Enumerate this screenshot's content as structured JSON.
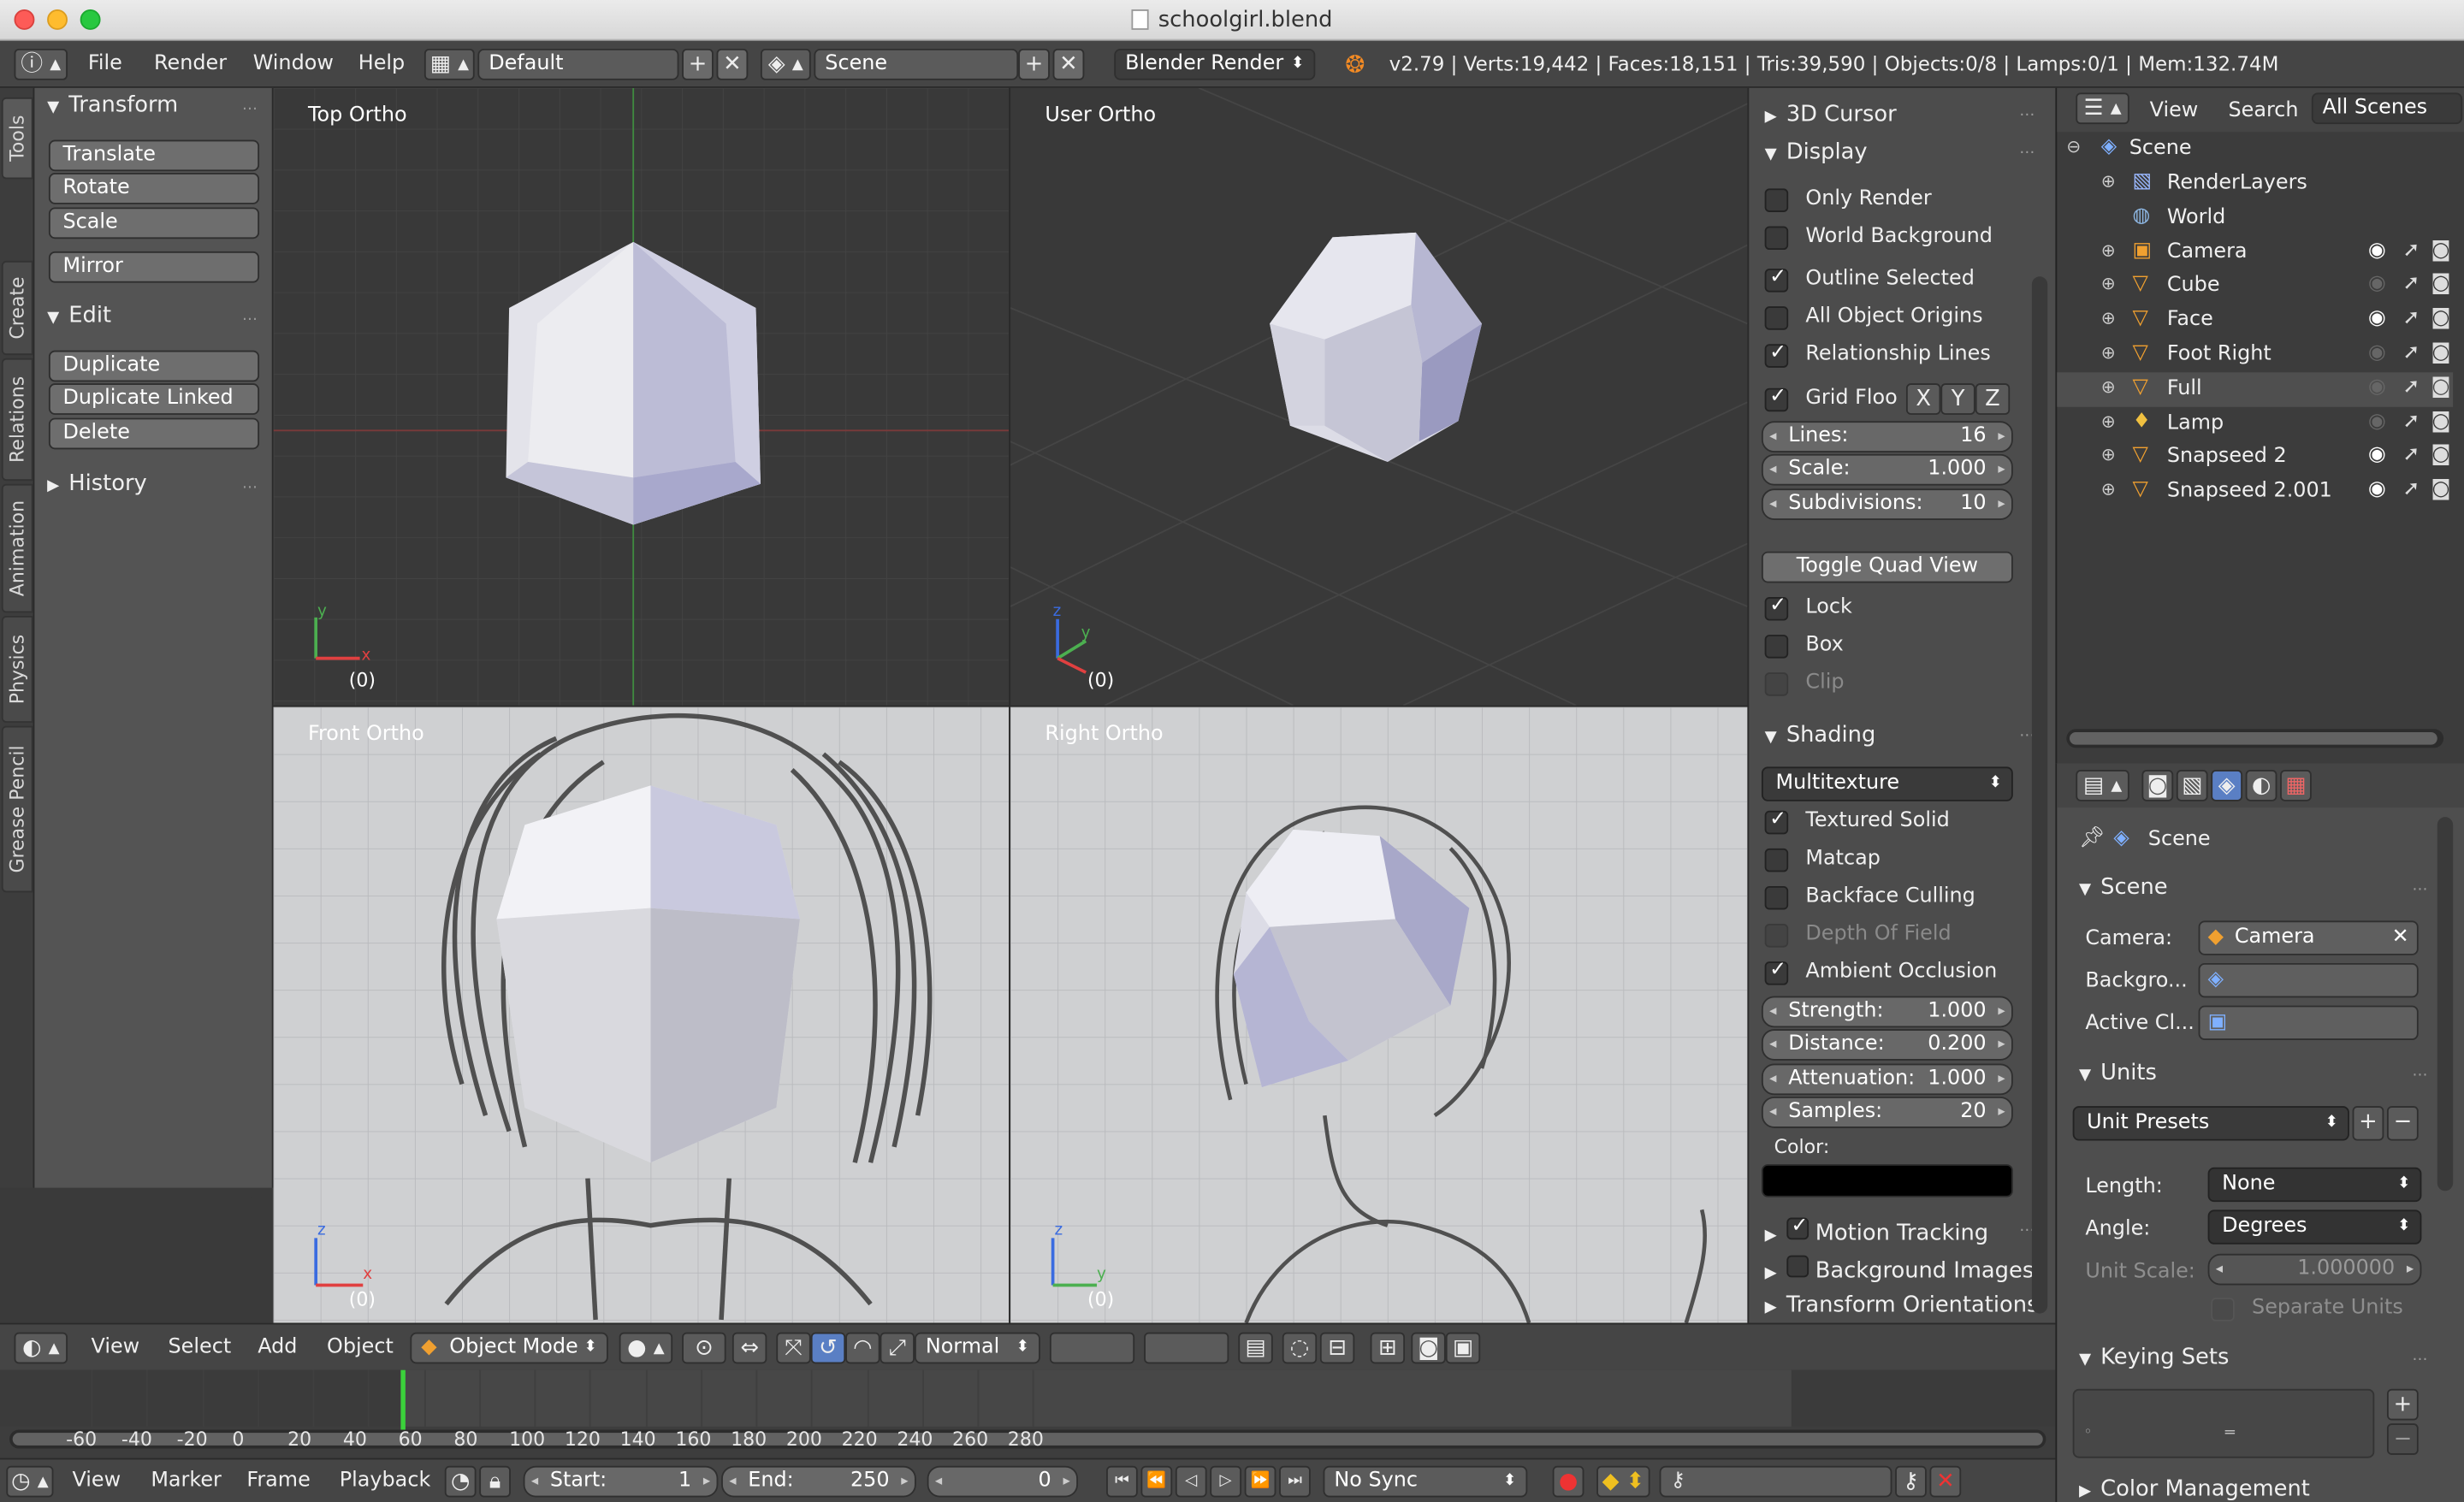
{
  "window": {
    "title": "schoolgirl.blend"
  },
  "info_header": {
    "menus": [
      "File",
      "Render",
      "Window",
      "Help"
    ],
    "screen_layout": "Default",
    "scene": "Scene",
    "render_engine": "Blender Render",
    "stats": "v2.79 | Verts:19,442 | Faces:18,151 | Tris:39,590 | Objects:0/8 | Lamps:0/1 | Mem:132.74M"
  },
  "tool_tabs": [
    "Tools",
    "Create",
    "Relations",
    "Animation",
    "Physics",
    "Grease Pencil"
  ],
  "tool_shelf": {
    "transform": {
      "title": "Transform",
      "buttons": [
        "Translate",
        "Rotate",
        "Scale",
        "Mirror"
      ]
    },
    "edit": {
      "title": "Edit",
      "buttons": [
        "Duplicate",
        "Duplicate Linked",
        "Delete"
      ]
    },
    "history": {
      "title": "History"
    }
  },
  "viewports": {
    "top": {
      "label": "Top Ortho",
      "frame": "(0)"
    },
    "user": {
      "label": "User Ortho",
      "frame": "(0)"
    },
    "front": {
      "label": "Front Ortho",
      "frame": "(0)"
    },
    "right": {
      "label": "Right Ortho",
      "frame": "(0)"
    },
    "axes": {
      "x": "x",
      "y": "y",
      "z": "z"
    }
  },
  "properties_panel": {
    "cursor": "3D Cursor",
    "display": {
      "title": "Display",
      "checks": [
        {
          "label": "Only Render",
          "checked": false
        },
        {
          "label": "World Background",
          "checked": false
        },
        {
          "label": "Outline Selected",
          "checked": true
        },
        {
          "label": "All Object Origins",
          "checked": false
        },
        {
          "label": "Relationship Lines",
          "checked": true
        }
      ],
      "grid_floor": {
        "label": "Grid Floo",
        "checked": true,
        "axes": [
          "X",
          "Y",
          "Z"
        ]
      },
      "fields": [
        {
          "label": "Lines:",
          "value": "16"
        },
        {
          "label": "Scale:",
          "value": "1.000"
        },
        {
          "label": "Subdivisions:",
          "value": "10"
        }
      ],
      "toggle_quad": "Toggle Quad View",
      "quad_checks": [
        {
          "label": "Lock",
          "checked": true
        },
        {
          "label": "Box",
          "checked": false
        },
        {
          "label": "Clip",
          "checked": false
        }
      ]
    },
    "shading": {
      "title": "Shading",
      "mode": "Multitexture",
      "checks": [
        {
          "label": "Textured Solid",
          "checked": true
        },
        {
          "label": "Matcap",
          "checked": false
        },
        {
          "label": "Backface Culling",
          "checked": false
        },
        {
          "label": "Depth Of Field",
          "checked": false
        },
        {
          "label": "Ambient Occlusion",
          "checked": true
        }
      ],
      "fields": [
        {
          "label": "Strength:",
          "value": "1.000"
        },
        {
          "label": "Distance:",
          "value": "0.200"
        },
        {
          "label": "Attenuation:",
          "value": "1.000"
        },
        {
          "label": "Samples:",
          "value": "20"
        }
      ],
      "color_label": "Color:",
      "color": "#000000"
    },
    "collapsed": [
      "Motion Tracking",
      "Background Images",
      "Transform Orientations"
    ]
  },
  "view3d_header": {
    "menus": [
      "View",
      "Select",
      "Add",
      "Object"
    ],
    "mode": "Object Mode",
    "orientation": "Normal"
  },
  "timeline": {
    "ticks": [
      "-60",
      "-40",
      "-20",
      "0",
      "20",
      "40",
      "60",
      "80",
      "100",
      "120",
      "140",
      "160",
      "180",
      "200",
      "220",
      "240",
      "260",
      "280"
    ],
    "menus": [
      "View",
      "Marker",
      "Frame",
      "Playback"
    ],
    "start_label": "Start:",
    "start": "1",
    "end_label": "End:",
    "end": "250",
    "current": "0",
    "sync": "No Sync"
  },
  "outliner": {
    "header": [
      "View",
      "Search",
      "All Scenes"
    ],
    "root": "Scene",
    "items": [
      {
        "name": "RenderLayers",
        "icon": "render-layers-icon"
      },
      {
        "name": "World",
        "icon": "world-icon"
      },
      {
        "name": "Camera",
        "icon": "camera-icon"
      },
      {
        "name": "Cube",
        "icon": "mesh-icon"
      },
      {
        "name": "Face",
        "icon": "mesh-icon"
      },
      {
        "name": "Foot Right",
        "icon": "mesh-icon"
      },
      {
        "name": "Full",
        "icon": "mesh-icon"
      },
      {
        "name": "Lamp",
        "icon": "lamp-icon"
      },
      {
        "name": "Snapseed 2",
        "icon": "mesh-icon"
      },
      {
        "name": "Snapseed 2.001",
        "icon": "mesh-icon"
      }
    ]
  },
  "scene_props": {
    "context": "Scene",
    "scene_panel": {
      "title": "Scene",
      "camera_label": "Camera:",
      "camera": "Camera",
      "background_label": "Backgro...",
      "active_clip_label": "Active Cl..."
    },
    "units_panel": {
      "title": "Units",
      "presets": "Unit Presets",
      "length_label": "Length:",
      "length": "None",
      "angle_label": "Angle:",
      "angle": "Degrees",
      "unit_scale_label": "Unit Scale:",
      "unit_scale": "1.000000",
      "separate_units": "Separate Units"
    },
    "keying_sets": "Keying Sets",
    "color_management": "Color Management"
  }
}
